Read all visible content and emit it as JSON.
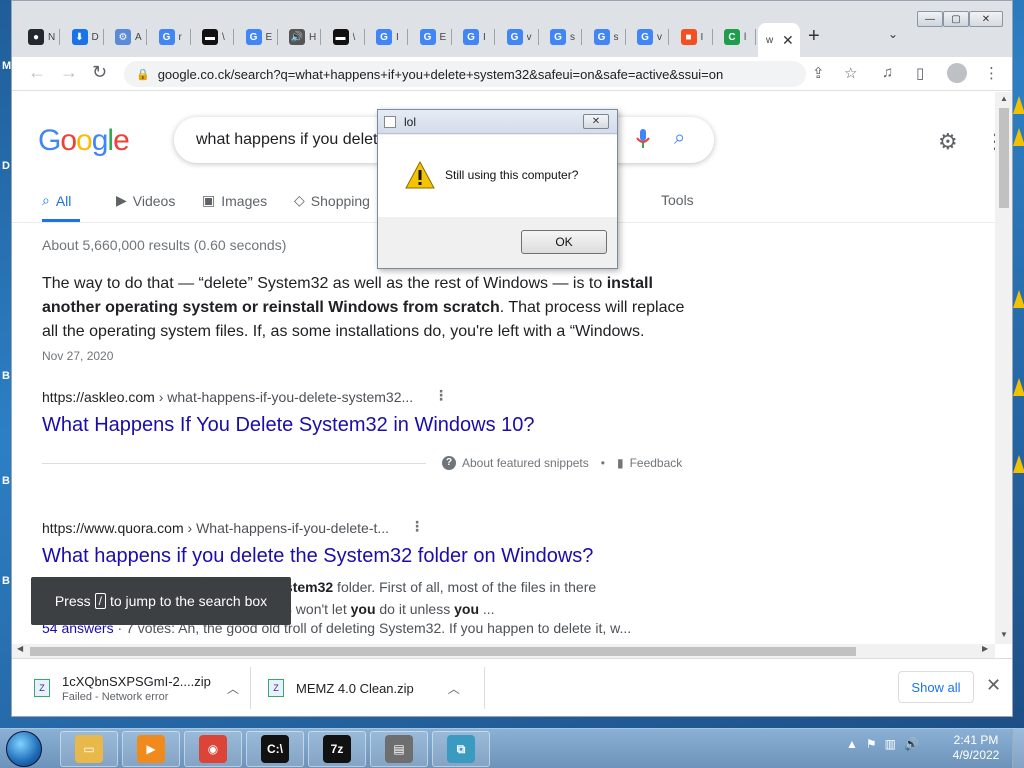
{
  "browser": {
    "tabs": [
      {
        "title": "N",
        "icon": "github-icon",
        "color": "#24292f",
        "glyph": "●"
      },
      {
        "title": "D",
        "icon": "download-icon",
        "color": "#1a73e8",
        "glyph": "⬇"
      },
      {
        "title": "A",
        "icon": "globe-icon",
        "color": "#5b8ad8",
        "glyph": "⚙"
      },
      {
        "title": "r",
        "icon": "google-icon",
        "color": "#4285f4",
        "glyph": "G"
      },
      {
        "title": "\\",
        "icon": "video-icon",
        "color": "#111111",
        "glyph": "▬"
      },
      {
        "title": "E",
        "icon": "google-icon",
        "color": "#4285f4",
        "glyph": "G"
      },
      {
        "title": "H",
        "icon": "audio-icon",
        "color": "#555555",
        "glyph": "🔊"
      },
      {
        "title": "\\",
        "icon": "video-icon",
        "color": "#111111",
        "glyph": "▬"
      },
      {
        "title": "I",
        "icon": "google-icon",
        "color": "#4285f4",
        "glyph": "G"
      },
      {
        "title": "E",
        "icon": "google-icon",
        "color": "#4285f4",
        "glyph": "G"
      },
      {
        "title": "I",
        "icon": "google-icon",
        "color": "#4285f4",
        "glyph": "G"
      },
      {
        "title": "v",
        "icon": "google-icon",
        "color": "#4285f4",
        "glyph": "G"
      },
      {
        "title": "s",
        "icon": "google-icon",
        "color": "#4285f4",
        "glyph": "G"
      },
      {
        "title": "s",
        "icon": "google-icon",
        "color": "#4285f4",
        "glyph": "G"
      },
      {
        "title": "v",
        "icon": "google-icon",
        "color": "#4285f4",
        "glyph": "G"
      },
      {
        "title": "I",
        "icon": "microsoft-icon",
        "color": "#f25022",
        "glyph": "■"
      },
      {
        "title": "l",
        "icon": "crypto-icon",
        "color": "#1e9e4a",
        "glyph": "C"
      }
    ],
    "active_tab": {
      "title": "w",
      "close": "✕"
    },
    "new_tab": "+",
    "tab_search": "⌄",
    "window_controls": {
      "minimize": "—",
      "maximize": "▢",
      "close": "✕"
    },
    "nav": {
      "back": "←",
      "forward": "→",
      "reload": "↻"
    },
    "url": "google.co.ck/search?q=what+happens+if+you+delete+system32&safeui=on&safe=active&ssui=on",
    "toolbar_icons": {
      "share": "⇪",
      "bookmark": "☆",
      "media": "♫",
      "sidepanel": "▯",
      "menu": "⋮"
    }
  },
  "google": {
    "query": "what happens if you delet",
    "settings": "⚙",
    "apps": "⋮",
    "tabs": [
      {
        "label": "All",
        "icon": "search-icon",
        "glyph": "⌕"
      },
      {
        "label": "Videos",
        "icon": "video-icon",
        "glyph": "▶"
      },
      {
        "label": "Images",
        "icon": "image-icon",
        "glyph": "▣"
      },
      {
        "label": "Shopping",
        "icon": "tag-icon",
        "glyph": "◇"
      }
    ],
    "tools": "Tools",
    "result_stats": "About 5,660,000 results (0.60 seconds)",
    "snippet": {
      "part1": "The way to do that — “delete” System32 as well as the rest of Windows — is to ",
      "bold": "install another operating system or reinstall Windows from scratch",
      "part2": ". That process will replace all the operating system files. If, as some installations do, you're left with a “Windows.",
      "date": "Nov 27, 2020"
    },
    "results": [
      {
        "domain": "https://askleo.com",
        "path": " › what-happens-if-you-delete-system32...",
        "title": "What Happens If You Delete System32 in Windows 10?"
      },
      {
        "domain": "https://www.quora.com",
        "path": " › What-happens-if-you-delete-t...",
        "title": "What happens if you delete the System32 folder on Windows?"
      }
    ],
    "featured": {
      "about": "About featured snippets",
      "feedback": "Feedback"
    },
    "quora_snippet": {
      "line1_bold": "r system32",
      "line1": " folder. First of all, most of the files in there",
      "line2a": "e OS won't let ",
      "line2b": "you",
      "line2c": " do it unless ",
      "line2d": "you",
      "line2e": " ..."
    },
    "quora_meta": {
      "answers": "54 answers",
      "rest": " · 7 votes: Ah, the good old troll of deleting System32. If you happen to delete it, w..."
    },
    "kbd_toast": {
      "press": "Press",
      "key": "/",
      "rest": "to jump to the search box"
    }
  },
  "downloads": [
    {
      "name": "1cXQbnSXPSGmI-2....zip",
      "status": "Failed - Network error"
    },
    {
      "name": "MEMZ 4.0 Clean.zip",
      "status": ""
    }
  ],
  "show_all": "Show all",
  "dialog": {
    "title": "lol",
    "message": "Still using this computer?",
    "ok": "OK",
    "close": "✕"
  },
  "taskbar": {
    "time": "2:41 PM",
    "date": "4/9/2022",
    "apps": [
      {
        "name": "explorer",
        "icon": "folder-icon",
        "color": "#e8b84a",
        "glyph": "▭"
      },
      {
        "name": "media-player",
        "icon": "media-player-icon",
        "color": "#f08a1c",
        "glyph": "▶"
      },
      {
        "name": "chrome",
        "icon": "chrome-icon",
        "color": "#db4437",
        "glyph": "◉"
      },
      {
        "name": "cmd",
        "icon": "terminal-icon",
        "color": "#111111",
        "glyph": "C:\\"
      },
      {
        "name": "7zip",
        "icon": "7zip-icon",
        "color": "#111111",
        "glyph": "7z"
      },
      {
        "name": "memz",
        "icon": "document-icon",
        "color": "#6e6e6e",
        "glyph": "▤"
      },
      {
        "name": "network",
        "icon": "network-icon",
        "color": "#3b9ac0",
        "glyph": "⧉"
      }
    ],
    "tray": [
      "▲",
      "⚑",
      "▥",
      "🔊"
    ]
  }
}
